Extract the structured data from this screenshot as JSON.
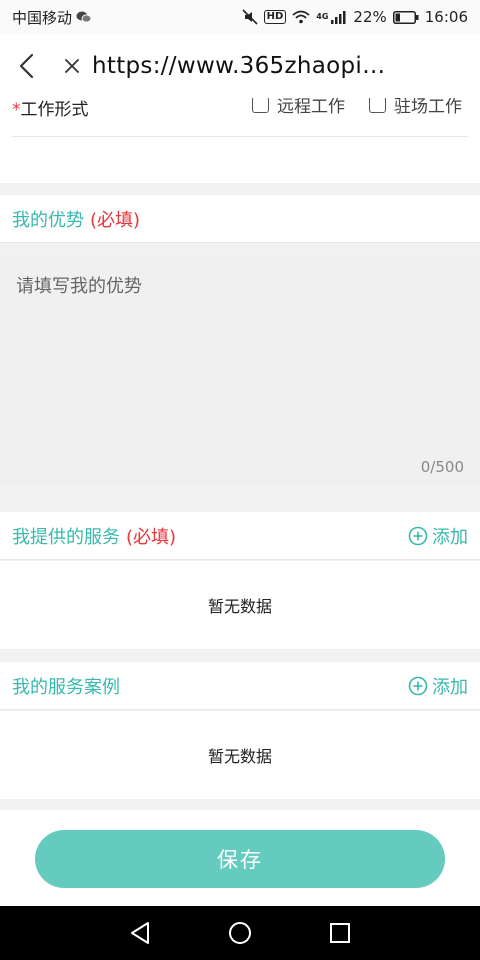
{
  "status_bar": {
    "carrier": "中国移动",
    "hd": "HD",
    "network": "4G",
    "battery": "22%",
    "time": "16:06"
  },
  "nav": {
    "url": "https://www.365zhaopin.c..."
  },
  "work_mode": {
    "required_mark": "*",
    "label": "工作形式",
    "options": [
      "远程工作",
      "驻场工作"
    ]
  },
  "advantage": {
    "title": "我的优势",
    "required": "(必填)",
    "placeholder": "请填写我的优势",
    "count": "0/500"
  },
  "services": {
    "title": "我提供的服务",
    "required": "(必填)",
    "add_label": "添加",
    "empty": "暂无数据"
  },
  "cases": {
    "title": "我的服务案例",
    "add_label": "添加",
    "empty": "暂无数据"
  },
  "footer": {
    "save_label": "保存"
  },
  "colors": {
    "accent": "#39b9ad",
    "button": "#66cbbf",
    "required": "#e8353a"
  }
}
